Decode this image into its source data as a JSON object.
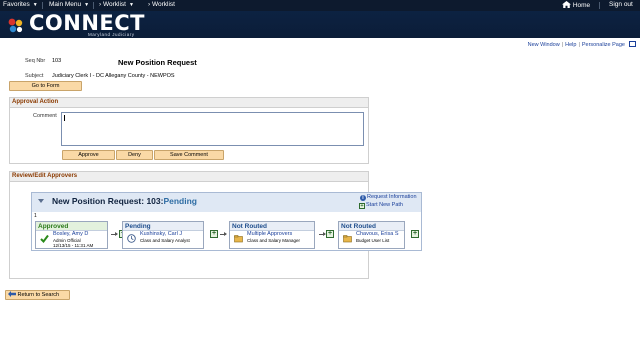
{
  "nav": {
    "favorites": "Favorites",
    "main_menu": "Main Menu",
    "worklist_menu": "Worklist",
    "worklist": "Worklist",
    "home": "Home",
    "sign_out": "Sign out"
  },
  "brand": {
    "name": "CONNECT",
    "subtitle": "Maryland Judiciary"
  },
  "page_links": {
    "new_window": "New Window",
    "help": "Help",
    "personalize": "Personalize Page"
  },
  "request": {
    "seq_label": "Seq Nbr",
    "seq_value": "103",
    "title": "New Position Request",
    "subject_label": "Subject",
    "subject_value": "Judiciary Clerk I - DC Allegany County - NEWPOS",
    "go_to_form": "Go to Form"
  },
  "approval_action": {
    "header": "Approval Action",
    "comment_label": "Comment",
    "comment_value": "",
    "approve": "Approve",
    "deny": "Deny",
    "save_comment": "Save Comment"
  },
  "review": {
    "header": "Review/Edit Approvers",
    "map_title": "New Position Request: 103:",
    "map_status": "Pending",
    "request_info": "Request Information",
    "start_new_path": "Start New Path",
    "path_number": "1",
    "steps": [
      {
        "status": "Approved",
        "name": "Bosley, Amy D",
        "role": "Admin Official",
        "date": "12/13/15 - 11:31 AM"
      },
      {
        "status": "Pending",
        "name": "Kushinsky, Carl J",
        "role": "Class and Salary Analyst",
        "date": ""
      },
      {
        "status": "Not Routed",
        "name": "Multiple Approvers",
        "role": "Class and Salary Manager",
        "date": ""
      },
      {
        "status": "Not Routed",
        "name": "Chavous, Erisa S",
        "role": "Budget User List",
        "date": ""
      }
    ]
  },
  "return_to_search": "Return to Search",
  "colors": {
    "nav_bg": "#0d1a2e",
    "header_bg": "#0c2242",
    "button_bg": "#fad9a6",
    "section_title": "#8b3a00",
    "link": "#1a3f9a",
    "approved": "#2a7a1a",
    "pending": "#2e6da4"
  }
}
